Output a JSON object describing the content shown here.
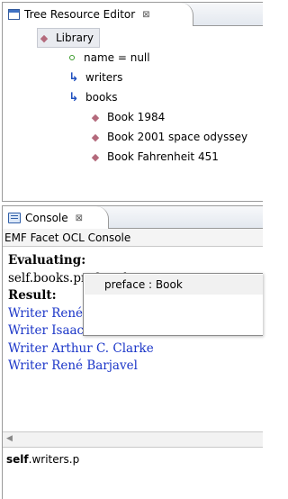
{
  "tree_editor": {
    "tab_title": "Tree Resource Editor",
    "close_glyph": "⊠",
    "nodes": [
      {
        "label": "Library",
        "icon": "diamond-icon"
      },
      {
        "label": "name = null",
        "icon": "attribute-icon"
      },
      {
        "label": "writers",
        "icon": "reference-icon"
      },
      {
        "label": "books",
        "icon": "reference-icon"
      },
      {
        "label": "Book 1984",
        "icon": "diamond-icon"
      },
      {
        "label": "Book 2001 space odyssey",
        "icon": "diamond-icon"
      },
      {
        "label": "Book Fahrenheit 451",
        "icon": "diamond-icon"
      }
    ]
  },
  "console": {
    "tab_title": "Console",
    "close_glyph": "⊠",
    "title": "EMF Facet OCL Console",
    "output": {
      "line1": "Evaluating:",
      "line2": "self.books.prefaced",
      "line3": "Result:",
      "results": [
        "Writer René Barjavel",
        "Writer Isaac Asimov",
        "Writer Arthur C. Clarke",
        "Writer René Barjavel"
      ]
    },
    "scroll_left_glyph": "◀",
    "input": {
      "keyword": "self",
      "rest": ".writers.p"
    },
    "completion": {
      "items": [
        "preface : Book"
      ]
    }
  },
  "colors": {
    "result_text": "#1a35c8",
    "class_icon": "#b46a7c",
    "attribute_icon": "#3a9a2a",
    "reference_icon": "#1f4fbf"
  }
}
